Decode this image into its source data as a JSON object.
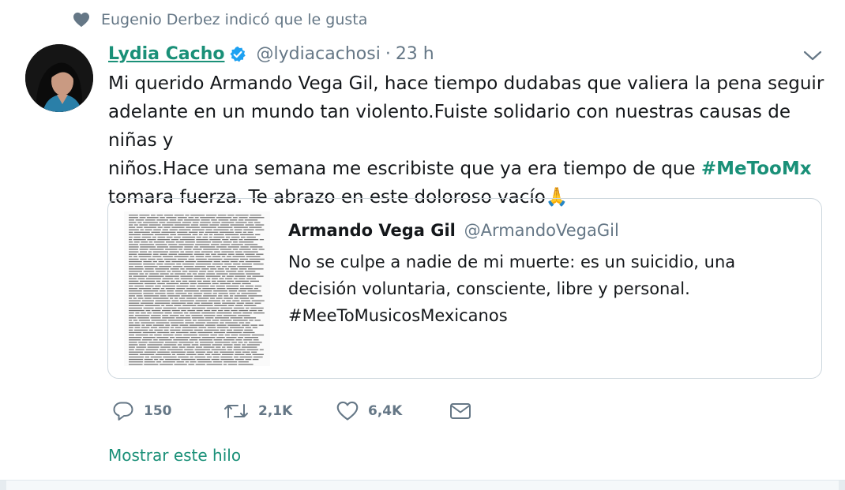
{
  "social_context": {
    "text": "Eugenio Derbez indicó que le gusta",
    "icon": "heart-icon"
  },
  "tweet": {
    "author_name": "Lydia Cacho",
    "handle": "@lydiacachosi",
    "separator": "·",
    "time": "23 h",
    "text_lines": [
      "Mi querido Armando Vega Gil, hace tiempo dudabas que valiera la pena seguir",
      "adelante en un mundo tan violento.Fuiste solidario con nuestras causas de niñas y",
      "niños.Hace una semana me escribiste que ya era tiempo de que "
    ],
    "hashtag": "#MeTooMx",
    "text_after_hashtag": "tomara fuerza. Te abrazo en este doloroso vacío",
    "emoji": "🙏"
  },
  "quote": {
    "author_name": "Armando Vega Gil",
    "handle": "@ArmandoVegaGil",
    "text_lines": [
      "No se culpe a nadie de mi muerte: es un suicidio, una",
      "decisión voluntaria, consciente, libre y personal.",
      "#MeeToMusicosMexicanos"
    ]
  },
  "actions": {
    "reply_count": "150",
    "retweet_count": "2,1K",
    "like_count": "6,4K"
  },
  "show_thread": "Mostrar este hilo",
  "colors": {
    "accent": "#1a9078",
    "muted": "#657786",
    "border": "#ccd6dd"
  }
}
